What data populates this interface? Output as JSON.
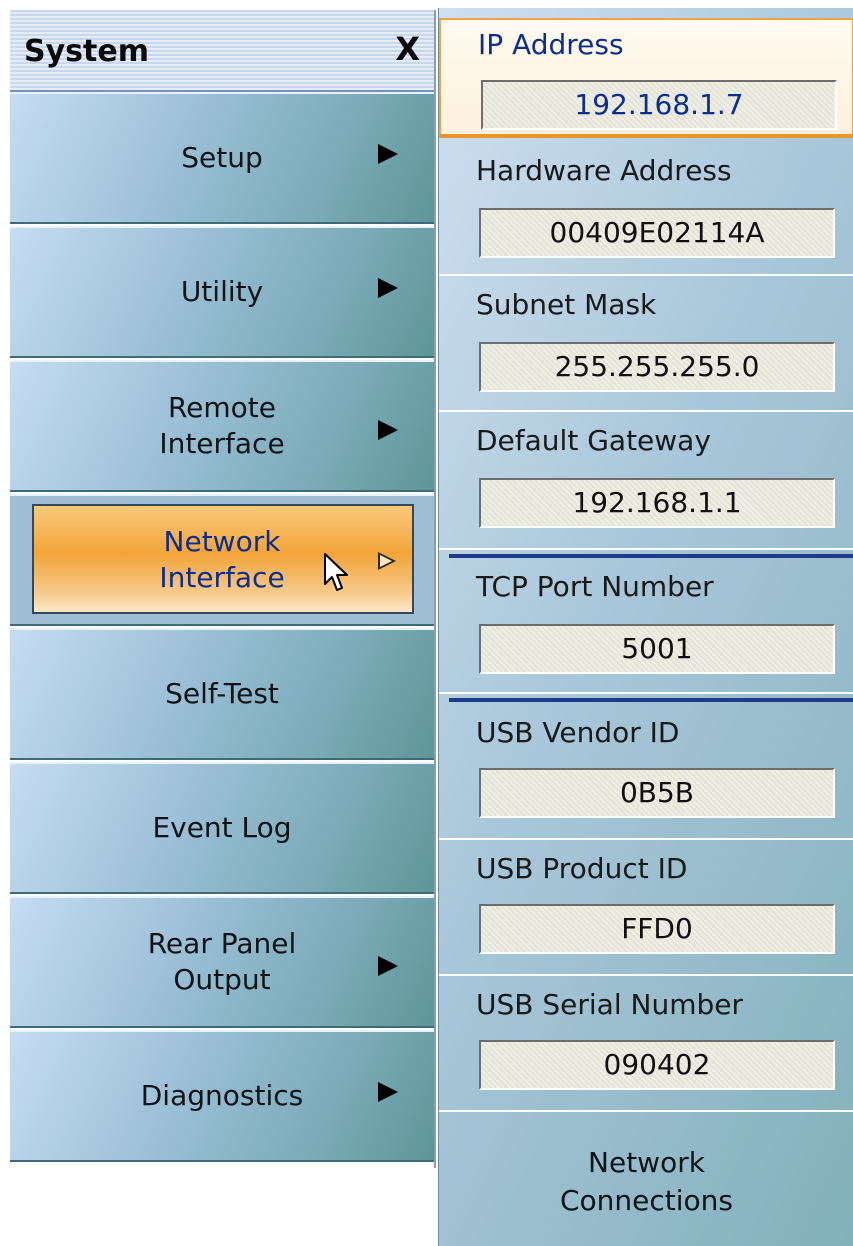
{
  "menu": {
    "title": "System",
    "close_label": "X",
    "items": [
      {
        "label": "Setup",
        "has_submenu": true
      },
      {
        "label": "Utility",
        "has_submenu": true
      },
      {
        "label": "Remote\nInterface",
        "has_submenu": true
      },
      {
        "label": "Network\nInterface",
        "has_submenu": true,
        "selected": true
      },
      {
        "label": "Self-Test",
        "has_submenu": false
      },
      {
        "label": "Event Log",
        "has_submenu": false
      },
      {
        "label": "Rear Panel\nOutput",
        "has_submenu": true
      },
      {
        "label": "Diagnostics",
        "has_submenu": true
      }
    ]
  },
  "panel": {
    "fields": [
      {
        "label": "IP Address",
        "value": "192.168.1.7"
      },
      {
        "label": "Hardware Address",
        "value": "00409E02114A"
      },
      {
        "label": "Subnet Mask",
        "value": "255.255.255.0"
      },
      {
        "label": "Default Gateway",
        "value": "192.168.1.1"
      },
      {
        "label": "TCP Port Number",
        "value": "5001"
      },
      {
        "label": "USB Vendor ID",
        "value": "0B5B"
      },
      {
        "label": "USB Product ID",
        "value": "FFD0"
      },
      {
        "label": "USB Serial Number",
        "value": "090402"
      }
    ],
    "network_connections_label": "Network\nConnections"
  },
  "colors": {
    "selection_orange": "#f2a43a",
    "selected_text": "#0b2e8f",
    "divider": "#1d3a8c"
  }
}
